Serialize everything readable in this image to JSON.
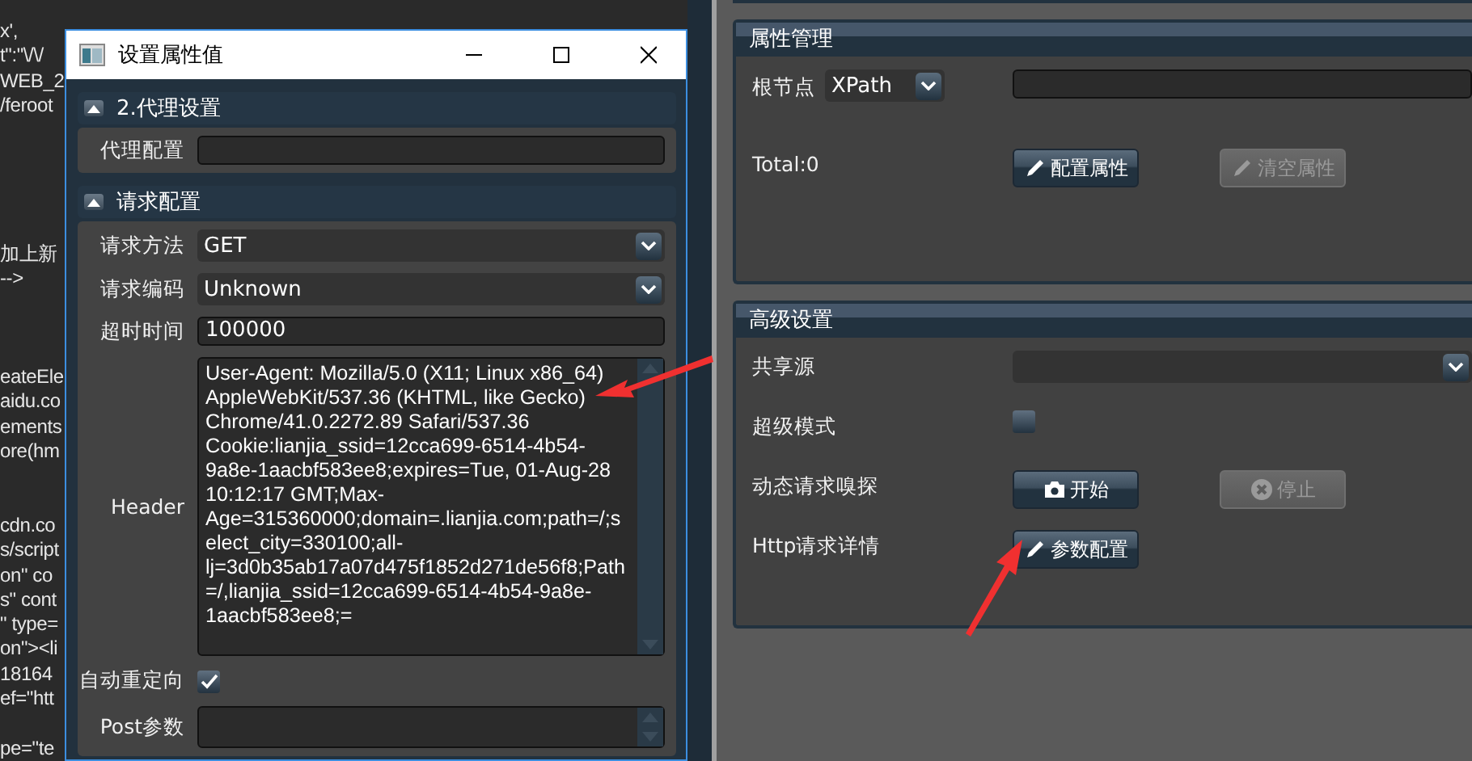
{
  "code_editor": {
    "blocks": [
      [
        "x',",
        "t\":\"\\/\\/",
        "WEB_2",
        "/feroot"
      ],
      [
        "加上新",
        "-->"
      ],
      [
        "eateEle",
        "aidu.co",
        "ements",
        "ore(hm"
      ],
      [
        "cdn.co",
        "s/script",
        "on\" co",
        "s\" cont",
        "\" type=",
        "on\"><li",
        "18164",
        "ef=\"htt"
      ],
      [
        "pe=\"te"
      ]
    ]
  },
  "dialog": {
    "title": "设置属性值",
    "sections": [
      {
        "title": "2.代理设置",
        "expanded": true,
        "rows": [
          {
            "kind": "field",
            "label": "代理配置"
          }
        ]
      },
      {
        "title": "请求配置",
        "expanded": true,
        "rows": [
          {
            "kind": "combo",
            "label": "请求方法",
            "value": "GET"
          },
          {
            "kind": "combo",
            "label": "请求编码",
            "value": "Unknown"
          },
          {
            "kind": "field",
            "label": "超时时间",
            "value": "100000"
          },
          {
            "kind": "textarea",
            "label": "Header",
            "value": "User-Agent: Mozilla/5.0 (X11; Linux x86_64) AppleWebKit/537.36 (KHTML, like Gecko) Chrome/41.0.2272.89 Safari/537.36\nCookie:lianjia_ssid=12cca699-6514-4b54-9a8e-1aacbf583ee8;expires=Tue, 01-Aug-28 10:12:17 GMT;Max-Age=315360000;domain=.lianjia.com;path=/;select_city=330100;all-lj=3d0b35ab17a07d475f1852d271de56f8;Path=/,lianjia_ssid=12cca699-6514-4b54-9a8e-1aacbf583ee8;="
          },
          {
            "kind": "checkbox",
            "label": "自动重定向",
            "checked": true
          },
          {
            "kind": "textarea",
            "label": "Post参数"
          }
        ]
      }
    ]
  },
  "panels": [
    {
      "title": "属性管理",
      "rows": [
        {
          "label": "根节点",
          "inline": {
            "kind": "combo",
            "value": "XPath"
          },
          "controls": [
            {
              "kind": "field"
            }
          ]
        },
        {
          "label": "Total:0",
          "controls": [
            {
              "kind": "button",
              "label": "配置属性",
              "disabled": false
            },
            {
              "kind": "button",
              "label": "清空属性",
              "disabled": true
            }
          ]
        }
      ]
    },
    {
      "title": "高级设置",
      "rows": [
        {
          "label": "共享源",
          "controls": [
            {
              "kind": "combo"
            }
          ]
        },
        {
          "label": "超级模式",
          "controls": [
            {
              "kind": "checkbox",
              "checked": false
            }
          ]
        },
        {
          "label": "动态请求嗅探",
          "controls": [
            {
              "kind": "button",
              "label": "开始",
              "disabled": false
            },
            {
              "kind": "button",
              "label": "停止",
              "disabled": true
            }
          ]
        },
        {
          "label": "Http请求详情",
          "controls": [
            {
              "kind": "button",
              "label": "参数配置",
              "disabled": false
            }
          ]
        }
      ]
    }
  ]
}
